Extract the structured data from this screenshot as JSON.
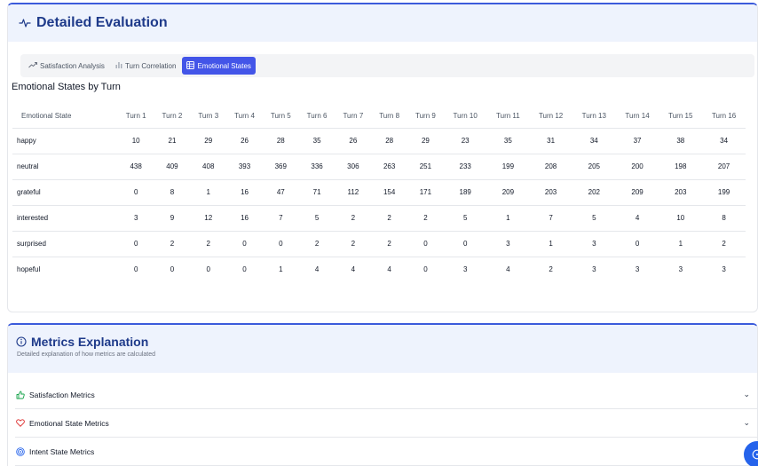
{
  "evaluation": {
    "title": "Detailed Evaluation",
    "tabs": [
      {
        "icon": "trend-up-icon",
        "label": "Satisfaction Analysis"
      },
      {
        "icon": "bar-chart-icon",
        "label": "Turn Correlation"
      },
      {
        "icon": "table-icon",
        "label": "Emotional States"
      }
    ],
    "active_tab": "Emotional States",
    "section_title": "Emotional States by Turn",
    "table": {
      "headers": [
        "Emotional State",
        "Turn 1",
        "Turn 2",
        "Turn 3",
        "Turn 4",
        "Turn 5",
        "Turn 6",
        "Turn 7",
        "Turn 8",
        "Turn 9",
        "Turn 10",
        "Turn 11",
        "Turn 12",
        "Turn 13",
        "Turn 14",
        "Turn 15",
        "Turn 16"
      ],
      "rows": [
        [
          "happy",
          "10",
          "21",
          "29",
          "26",
          "28",
          "35",
          "26",
          "28",
          "29",
          "23",
          "35",
          "31",
          "34",
          "37",
          "38",
          "34"
        ],
        [
          "neutral",
          "438",
          "409",
          "408",
          "393",
          "369",
          "336",
          "306",
          "263",
          "251",
          "233",
          "199",
          "208",
          "205",
          "200",
          "198",
          "207"
        ],
        [
          "grateful",
          "0",
          "8",
          "1",
          "16",
          "47",
          "71",
          "112",
          "154",
          "171",
          "189",
          "209",
          "203",
          "202",
          "209",
          "203",
          "199"
        ],
        [
          "interested",
          "3",
          "9",
          "12",
          "16",
          "7",
          "5",
          "2",
          "2",
          "2",
          "5",
          "1",
          "7",
          "5",
          "4",
          "10",
          "8"
        ],
        [
          "surprised",
          "0",
          "2",
          "2",
          "0",
          "0",
          "2",
          "2",
          "2",
          "0",
          "0",
          "3",
          "1",
          "3",
          "0",
          "1",
          "2"
        ],
        [
          "hopeful",
          "0",
          "0",
          "0",
          "0",
          "1",
          "4",
          "4",
          "4",
          "0",
          "3",
          "4",
          "2",
          "3",
          "3",
          "3",
          "3"
        ]
      ]
    }
  },
  "metrics": {
    "title": "Metrics Explanation",
    "subtitle": "Detailed explanation of how metrics are calculated",
    "items": [
      {
        "icon": "thumbs-up-icon",
        "label": "Satisfaction Metrics",
        "color": "#16a34a"
      },
      {
        "icon": "heart-icon",
        "label": "Emotional State Metrics",
        "color": "#dc2626"
      },
      {
        "icon": "target-icon",
        "label": "Intent State Metrics",
        "color": "#2563eb"
      }
    ]
  },
  "colors": {
    "accent": "#4355e8",
    "header_bg": "#eef3fd",
    "title": "#1e3a8a"
  }
}
